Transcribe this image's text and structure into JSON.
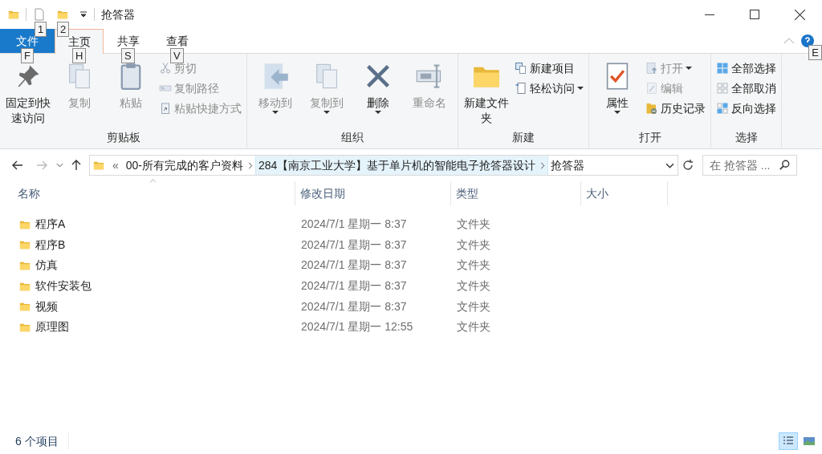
{
  "window": {
    "title": "抢答器",
    "quick_access_keytips": [
      "1",
      "2"
    ]
  },
  "ribbon_tabs": [
    {
      "label": "文件",
      "kind": "file",
      "keytip": "F",
      "selected": false
    },
    {
      "label": "主页",
      "kind": "tab",
      "keytip": "H",
      "selected": true
    },
    {
      "label": "共享",
      "kind": "tab",
      "keytip": "S",
      "selected": false
    },
    {
      "label": "查看",
      "kind": "tab",
      "keytip": "V",
      "selected": false
    }
  ],
  "help_keytip": "E",
  "ribbon_groups": [
    {
      "label": "剪贴板",
      "items": [
        {
          "kind": "large",
          "label": "固定到快速访问",
          "disabled": false,
          "dropdown": false
        },
        {
          "kind": "large",
          "label": "复制",
          "disabled": true,
          "dropdown": false
        },
        {
          "kind": "large",
          "label": "粘贴",
          "disabled": true,
          "dropdown": false
        },
        {
          "kind": "stack",
          "children": [
            {
              "label": "剪切",
              "disabled": true,
              "dropdown": false
            },
            {
              "label": "复制路径",
              "disabled": true,
              "dropdown": false
            },
            {
              "label": "粘贴快捷方式",
              "disabled": true,
              "dropdown": false
            }
          ]
        }
      ]
    },
    {
      "label": "组织",
      "items": [
        {
          "kind": "large",
          "label": "移动到",
          "disabled": true,
          "dropdown": true
        },
        {
          "kind": "large",
          "label": "复制到",
          "disabled": true,
          "dropdown": true
        },
        {
          "kind": "large",
          "label": "删除",
          "disabled": false,
          "dropdown": true
        },
        {
          "kind": "large",
          "label": "重命名",
          "disabled": true,
          "dropdown": false
        }
      ]
    },
    {
      "label": "新建",
      "items": [
        {
          "kind": "large",
          "label": "新建文件夹",
          "disabled": false,
          "dropdown": false
        },
        {
          "kind": "stack",
          "children": [
            {
              "label": "新建项目",
              "disabled": false,
              "dropdown": false
            },
            {
              "label": "轻松访问",
              "disabled": false,
              "dropdown": true
            }
          ]
        }
      ]
    },
    {
      "label": "打开",
      "items": [
        {
          "kind": "large",
          "label": "属性",
          "disabled": false,
          "dropdown": true
        },
        {
          "kind": "stack",
          "children": [
            {
              "label": "打开",
              "disabled": true,
              "dropdown": true
            },
            {
              "label": "编辑",
              "disabled": true,
              "dropdown": false
            },
            {
              "label": "历史记录",
              "disabled": false,
              "dropdown": false
            }
          ]
        }
      ]
    },
    {
      "label": "选择",
      "items": [
        {
          "kind": "stack",
          "children": [
            {
              "label": "全部选择",
              "disabled": false,
              "dropdown": false
            },
            {
              "label": "全部取消",
              "disabled": false,
              "dropdown": false
            },
            {
              "label": "反向选择",
              "disabled": false,
              "dropdown": false
            }
          ]
        }
      ]
    }
  ],
  "address_bar": {
    "overflow": "«",
    "crumbs": [
      {
        "label": "00-所有完成的客户资料",
        "selected": false
      },
      {
        "label": "284【南京工业大学】基于单片机的智能电子抢答器设计",
        "selected": true
      },
      {
        "label": "抢答器",
        "selected": false
      }
    ]
  },
  "search": {
    "placeholder": "在 抢答器 ..."
  },
  "table": {
    "columns": [
      "名称",
      "修改日期",
      "类型",
      "大小"
    ],
    "rows": [
      {
        "name": "程序A",
        "modified": "2024/7/1 星期一 8:37",
        "type": "文件夹"
      },
      {
        "name": "程序B",
        "modified": "2024/7/1 星期一 8:37",
        "type": "文件夹"
      },
      {
        "name": "仿真",
        "modified": "2024/7/1 星期一 8:37",
        "type": "文件夹"
      },
      {
        "name": "软件安装包",
        "modified": "2024/7/1 星期一 8:37",
        "type": "文件夹"
      },
      {
        "name": "视频",
        "modified": "2024/7/1 星期一 8:37",
        "type": "文件夹"
      },
      {
        "name": "原理图",
        "modified": "2024/7/1 星期一 12:55",
        "type": "文件夹"
      }
    ]
  },
  "status_bar": {
    "count": "6 个项目",
    "views": [
      {
        "kind": "details",
        "selected": true
      },
      {
        "kind": "tiles",
        "selected": false
      }
    ]
  }
}
